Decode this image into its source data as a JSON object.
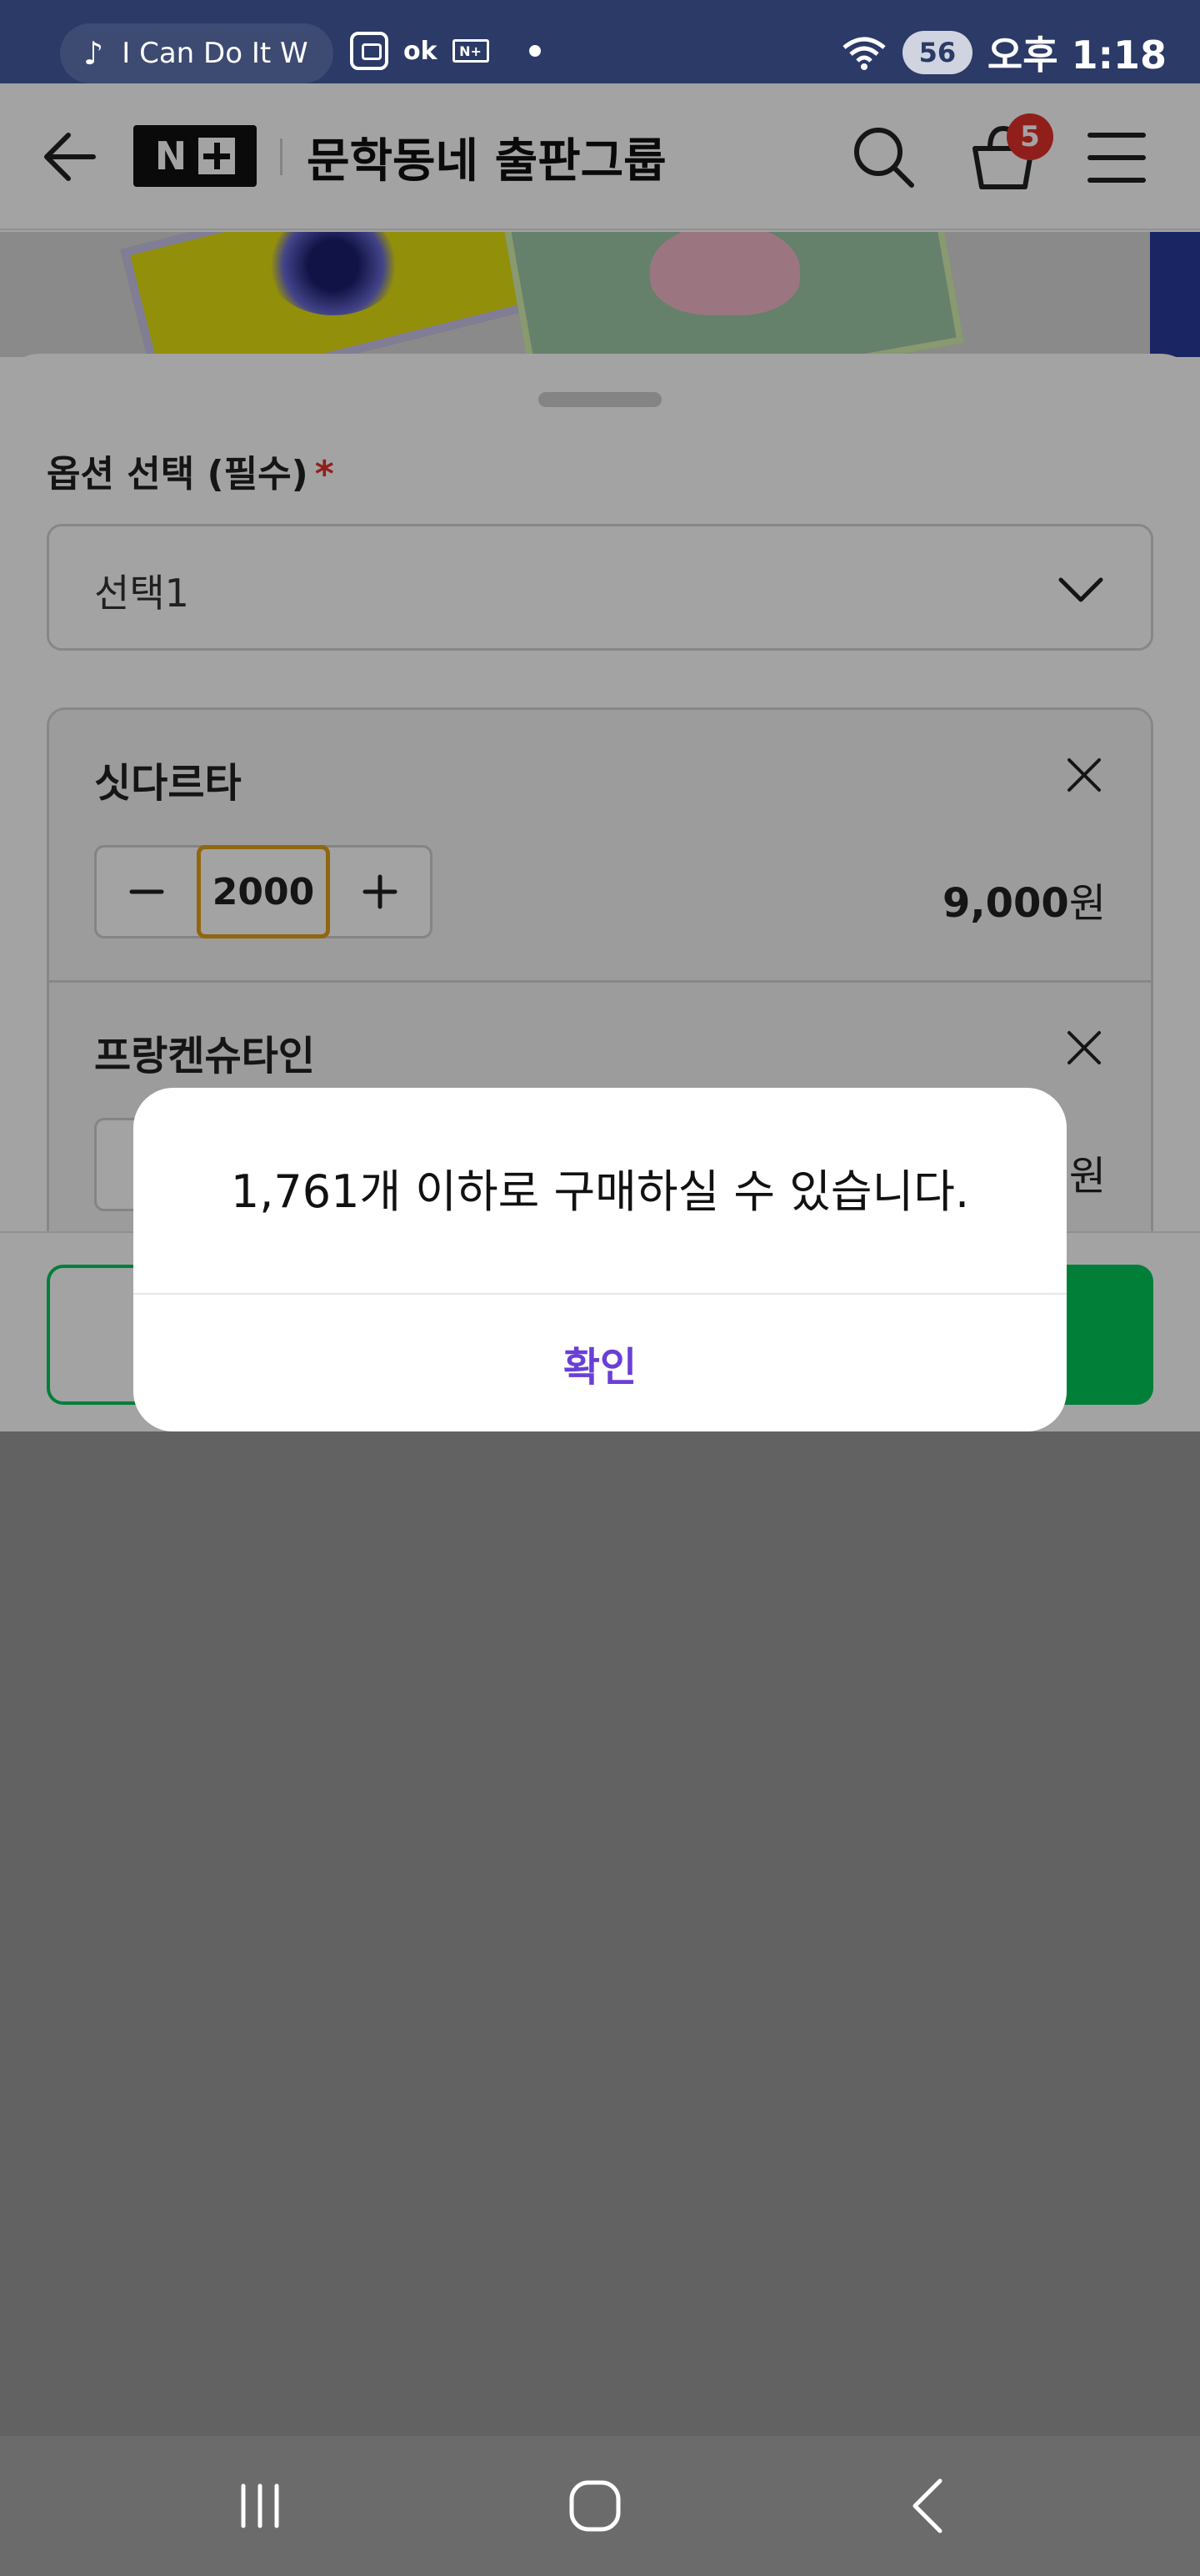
{
  "status_bar": {
    "media_text": "I Can Do It W",
    "battery": "56",
    "time": "오후 1:18",
    "ok_text": "ok"
  },
  "header": {
    "logo_text": "N",
    "title": "문학동네 출판그룹",
    "cart_count": "5"
  },
  "sheet": {
    "option_label": "옵션 선택 (필수)",
    "required_mark": "*",
    "select_value": "선택1",
    "items": [
      {
        "name": "싯다르타",
        "quantity": "2000",
        "price": "9,000",
        "currency": "원"
      },
      {
        "name": "프랑켄슈타인",
        "price_partial": "원"
      }
    ]
  },
  "dialog": {
    "message": "1,761개 이하로 구매하실 수 있습니다.",
    "confirm_label": "확인"
  },
  "colors": {
    "status_bar": "#2b3a66",
    "accent_green": "#03c75a",
    "required_red": "#e2312d",
    "confirm_purple": "#6a3fd6",
    "quantity_focus": "#e2a11a"
  },
  "icons": {
    "back": "arrow-left-icon",
    "search": "search-icon",
    "cart": "shopping-bag-icon",
    "menu": "hamburger-menu-icon",
    "select": "chevron-down-icon",
    "remove": "close-icon",
    "nav_recents": "recents-icon",
    "nav_home": "home-icon",
    "nav_back": "back-chevron-icon"
  }
}
